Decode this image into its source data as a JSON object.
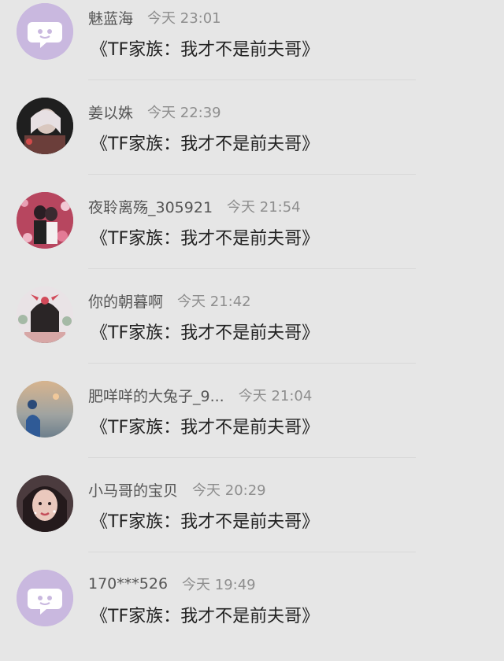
{
  "comments": [
    {
      "name": "魅蓝海",
      "time": "今天 23:01",
      "message": "《TF家族：我才不是前夫哥》",
      "avatar": "default-chat-avatar"
    },
    {
      "name": "姜以姝",
      "time": "今天 22:39",
      "message": "《TF家族：我才不是前夫哥》",
      "avatar": "user-photo-avatar"
    },
    {
      "name": "夜聆离殇_305921",
      "time": "今天 21:54",
      "message": "《TF家族：我才不是前夫哥》",
      "avatar": "user-photo-avatar"
    },
    {
      "name": "你的朝暮啊",
      "time": "今天 21:42",
      "message": "《TF家族：我才不是前夫哥》",
      "avatar": "user-illustration-avatar"
    },
    {
      "name": "肥咩咩的大兔子_9...",
      "time": "今天 21:04",
      "message": "《TF家族：我才不是前夫哥》",
      "avatar": "user-photo-avatar"
    },
    {
      "name": "小马哥的宝贝",
      "time": "今天 20:29",
      "message": "《TF家族：我才不是前夫哥》",
      "avatar": "user-photo-avatar"
    },
    {
      "name": "170***526",
      "time": "今天 19:49",
      "message": "《TF家族：我才不是前夫哥》",
      "avatar": "default-chat-avatar"
    }
  ],
  "colors": {
    "background": "#e6e6e6",
    "default_avatar": "#c9b8df",
    "name_text": "#555555",
    "time_text": "#8e8e8e",
    "message_text": "#222222"
  }
}
